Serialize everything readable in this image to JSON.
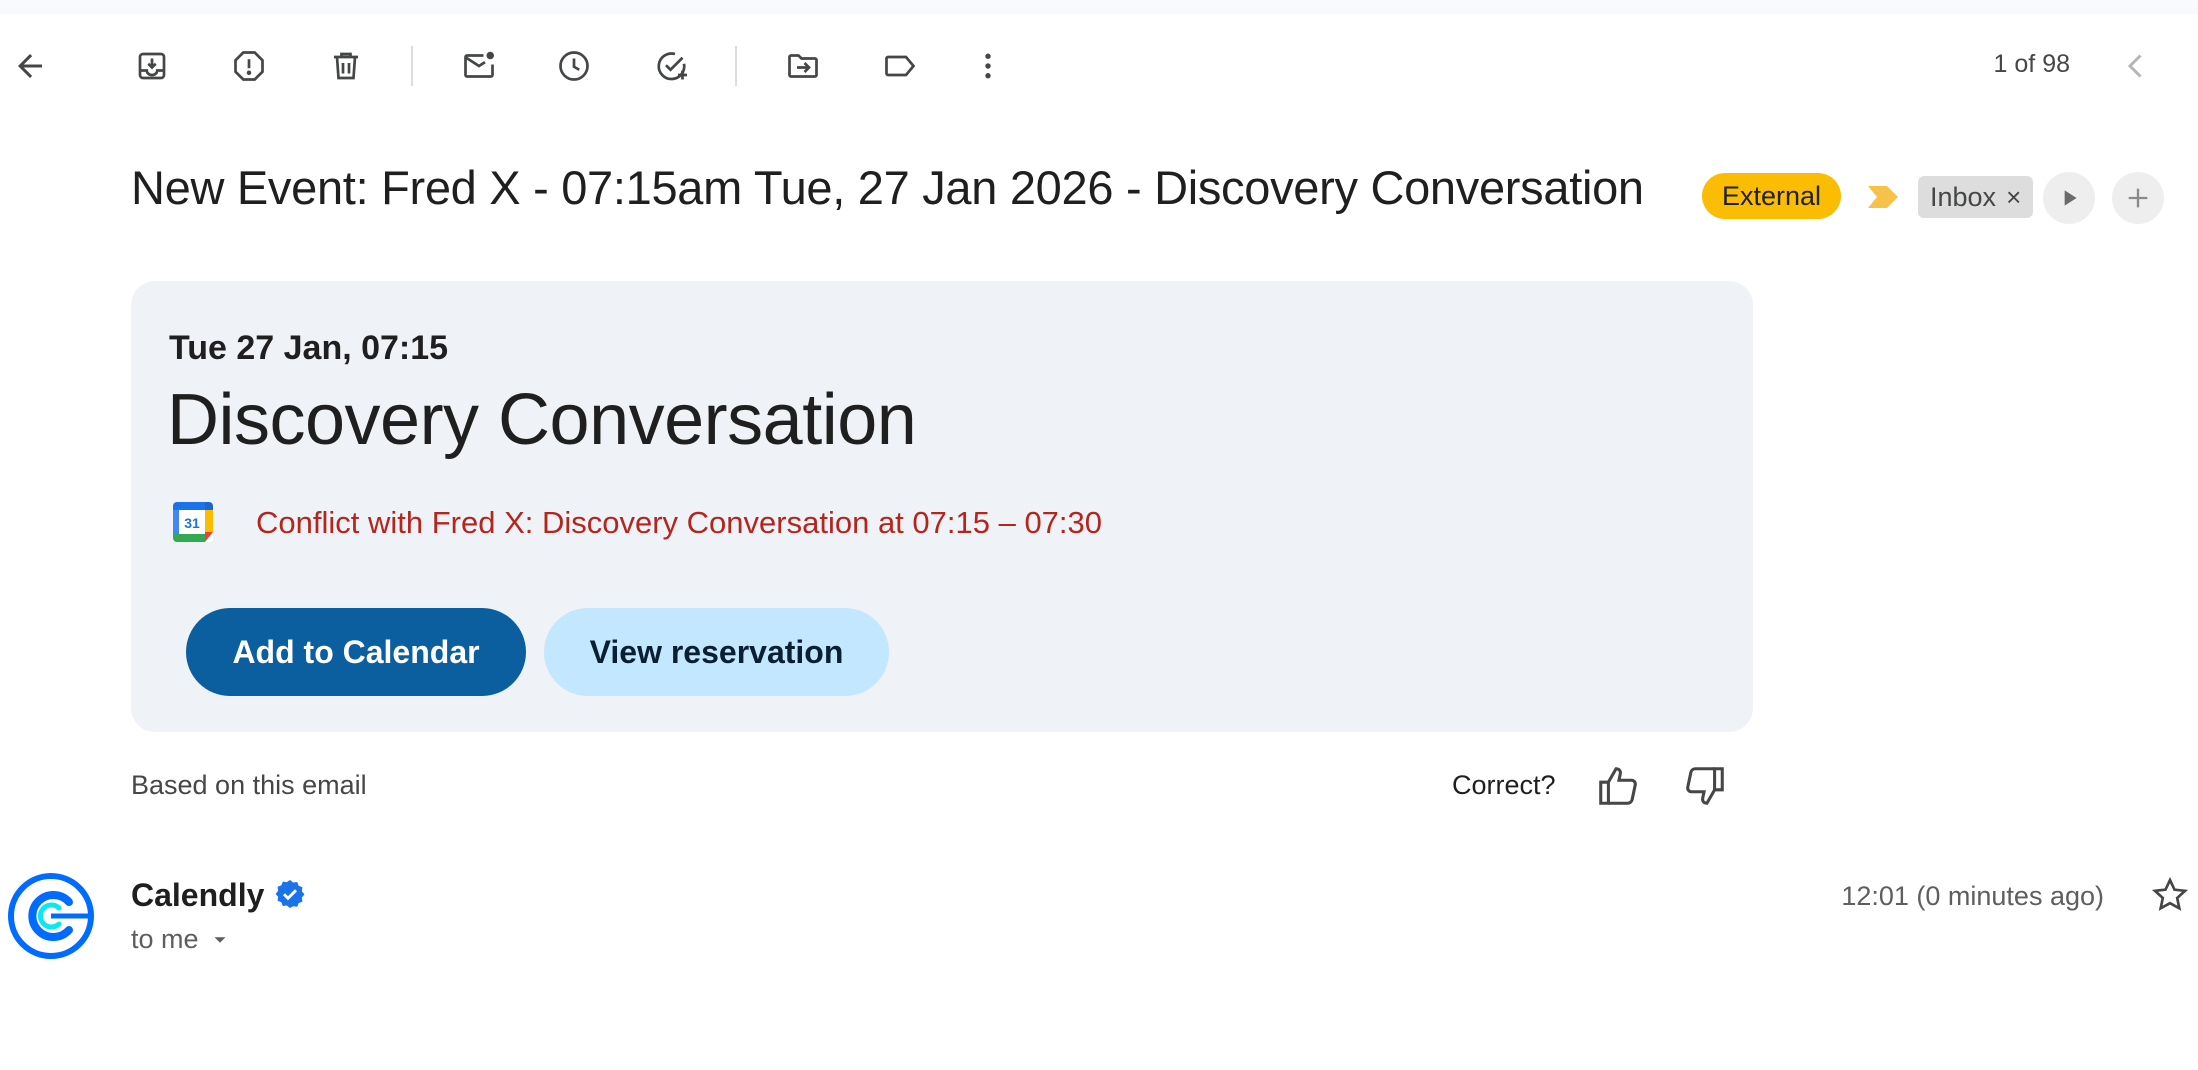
{
  "toolbar": {
    "buttons": [
      {
        "name": "back",
        "icon": "arrow-back-icon"
      },
      {
        "name": "archive",
        "icon": "archive-icon"
      },
      {
        "name": "report-spam",
        "icon": "report-spam-icon"
      },
      {
        "name": "delete",
        "icon": "trash-icon"
      },
      {
        "name": "mark-unread",
        "icon": "mark-unread-icon"
      },
      {
        "name": "snooze",
        "icon": "clock-icon"
      },
      {
        "name": "add-to-tasks",
        "icon": "add-task-icon"
      },
      {
        "name": "move-to",
        "icon": "move-to-folder-icon"
      },
      {
        "name": "labels",
        "icon": "label-icon"
      },
      {
        "name": "more",
        "icon": "more-vert-icon"
      }
    ],
    "counter": "1 of 98",
    "prev_icon": "chevron-left-icon"
  },
  "subject": {
    "text": "New Event: Fred X - 07:15am Tue, 27 Jan 2026 - Discovery Conversation",
    "external_label": "External",
    "inbox_label": "Inbox",
    "inbox_remove": "×"
  },
  "event_card": {
    "date": "Tue 27 Jan, 07:15",
    "title": "Discovery Conversation",
    "calendar_day": "31",
    "conflict": "Conflict with Fred X: Discovery Conversation at 07:15 – 07:30",
    "add_button": "Add to Calendar",
    "view_button": "View reservation"
  },
  "feedback": {
    "based_on": "Based on this email",
    "correct_prompt": "Correct?"
  },
  "message": {
    "sender": "Calendly",
    "recipient": "to me",
    "time": "12:01 (0 minutes ago)"
  },
  "colors": {
    "external_chip": "#fbbc04",
    "primary_button": "#0b5f9e",
    "secondary_button": "#c2e7ff",
    "conflict_text": "#b3261e",
    "card_background": "#eff2f7",
    "verified_badge": "#1a73e8",
    "calendly_blue": "#006bff"
  }
}
